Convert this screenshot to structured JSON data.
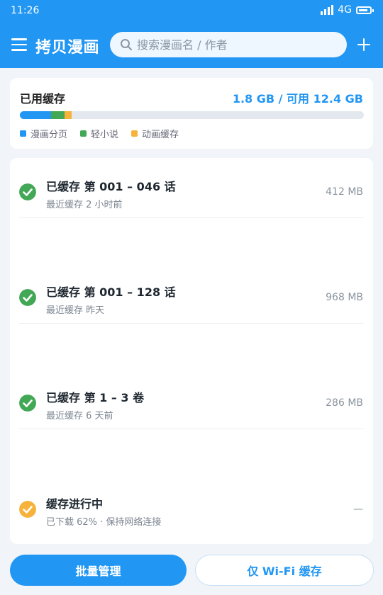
{
  "status_bar": {
    "time": "11:26",
    "network": "4G"
  },
  "header": {
    "title": "拷贝漫画",
    "search_placeholder": "搜索漫画名 / 作者"
  },
  "storage": {
    "label": "已用缓存",
    "value": "1.8 GB / 可用 12.4 GB",
    "breakdown": [
      {
        "name": "漫画分页",
        "fraction": 0.09,
        "color": "#2196f3"
      },
      {
        "name": "轻小说",
        "fraction": 0.04,
        "color": "#43a856"
      },
      {
        "name": "动画缓存",
        "fraction": 0.02,
        "color": "#f7b23b"
      }
    ]
  },
  "cache_items": [
    {
      "title": "已缓存 第 001 – 046 话",
      "subtitle": "最近缓存 2 小时前",
      "size": "412 MB",
      "state": "done"
    },
    {
      "title": "已缓存 第 001 – 128 话",
      "subtitle": "最近缓存 昨天",
      "size": "968 MB",
      "state": "done"
    },
    {
      "title": "已缓存 第 1 – 3 卷",
      "subtitle": "最近缓存 6 天前",
      "size": "286 MB",
      "state": "done"
    },
    {
      "title": "缓存进行中",
      "subtitle": "已下载 62% · 保持网络连接",
      "size": "—",
      "state": "in-progress"
    }
  ],
  "colors": {
    "accent": "#2196f3",
    "done": "#43a856",
    "in_progress": "#f7b23b"
  },
  "actions": {
    "batch_manage": "批量管理",
    "wifi_only": "仅 Wi-Fi 缓存"
  }
}
